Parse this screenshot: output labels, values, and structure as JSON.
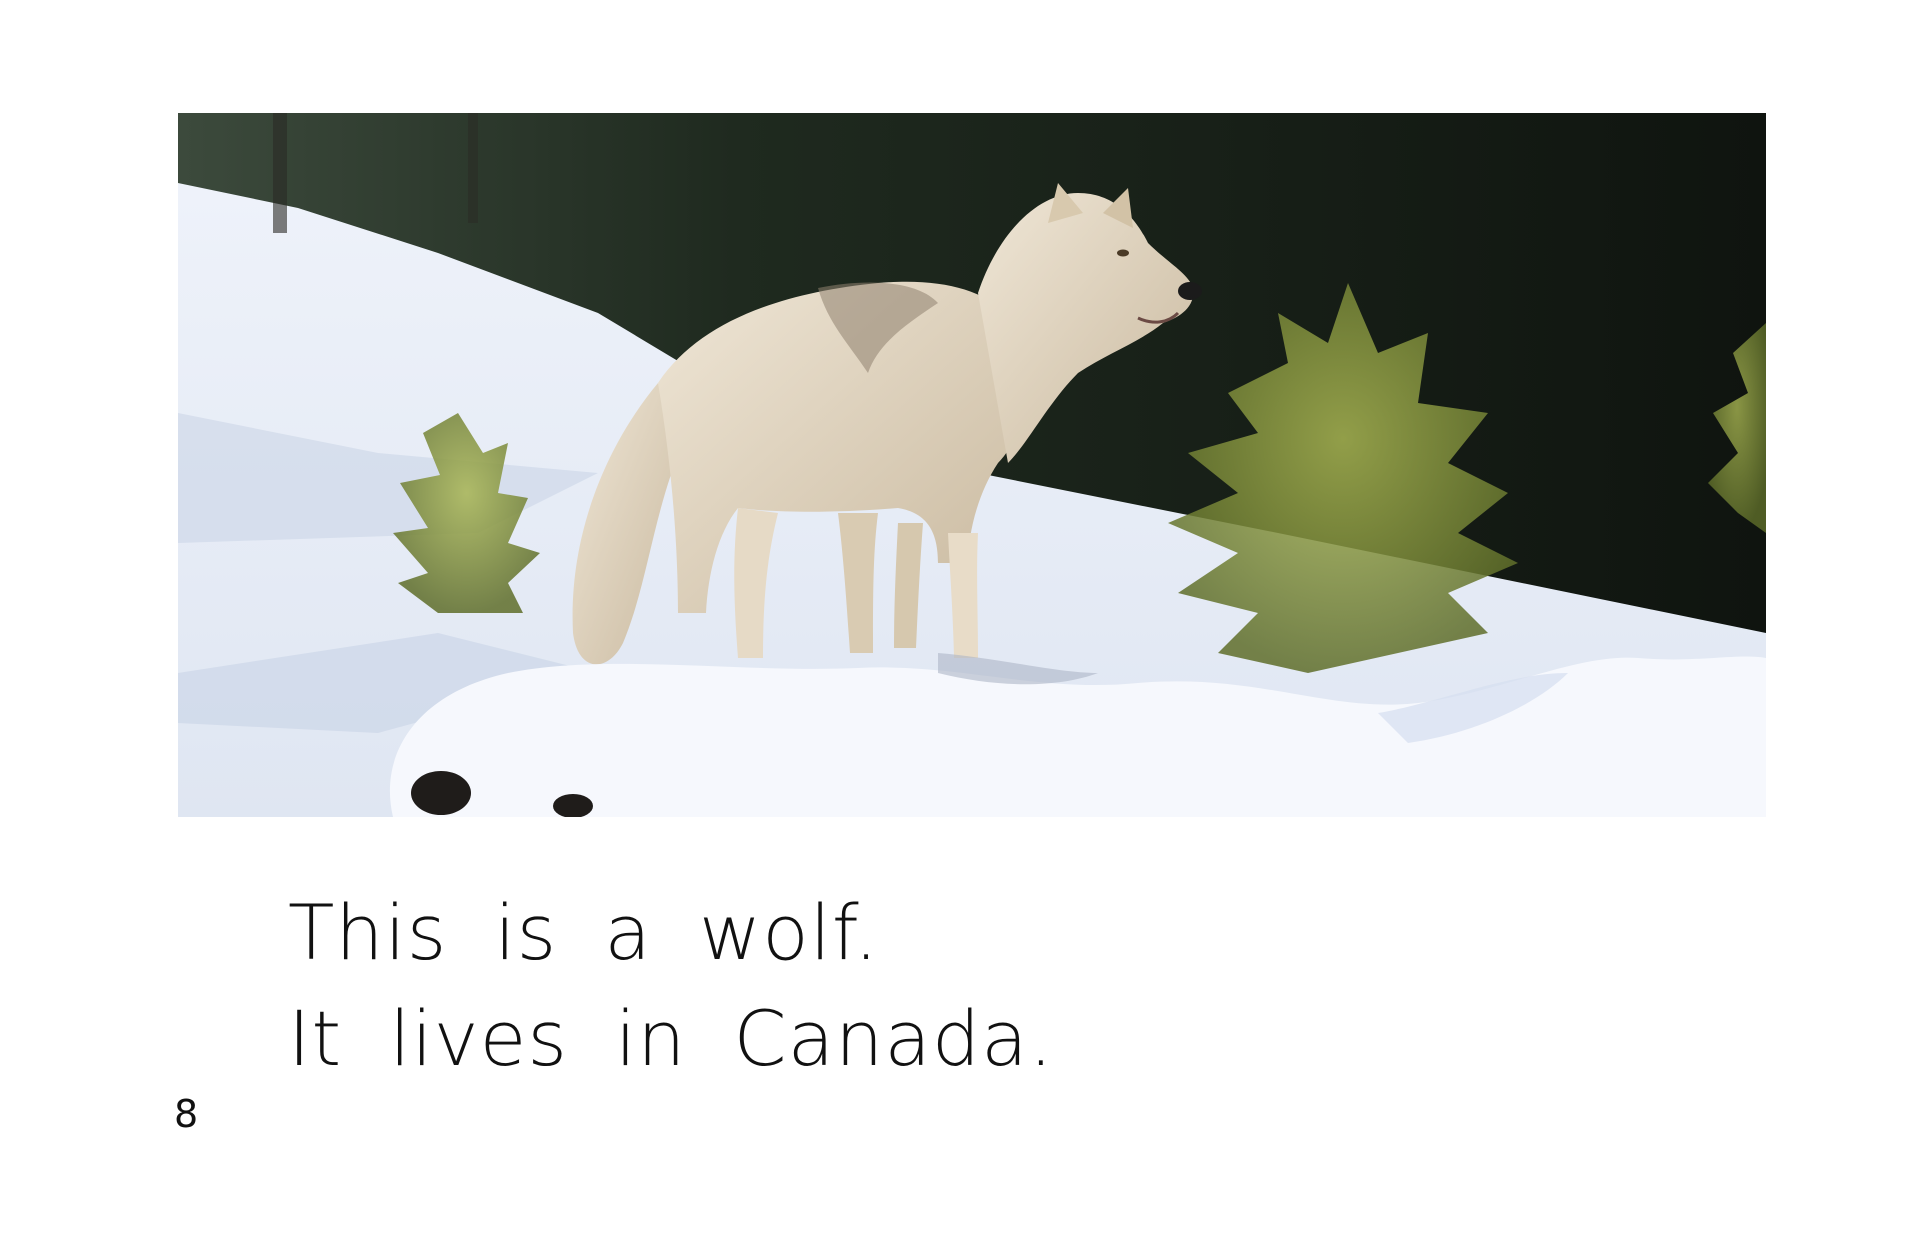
{
  "page": {
    "lines": [
      "This is a wolf.",
      "It lives in Canada."
    ],
    "page_number": "8"
  },
  "colors": {
    "background": "#ffffff",
    "text": "#111111",
    "snow": "#f2f5fb",
    "forest": "#1a2118",
    "wolf_fur": "#e2d6c2"
  }
}
